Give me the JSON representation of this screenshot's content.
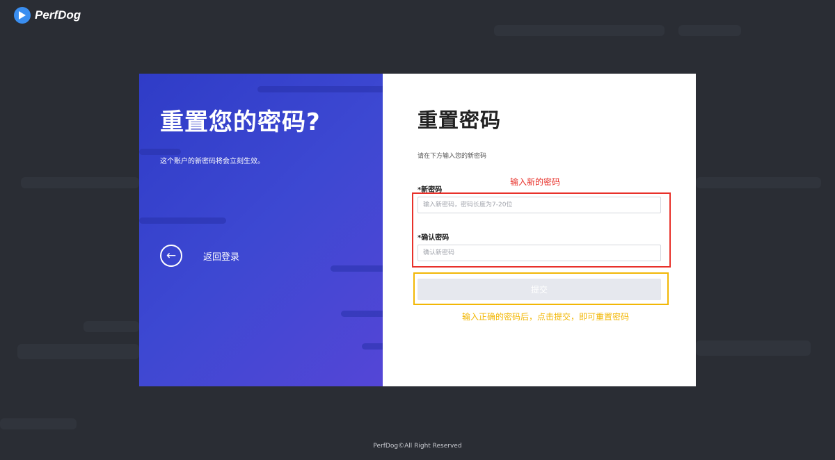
{
  "app": {
    "logo_text": "PerfDog"
  },
  "left_panel": {
    "title": "重置您的密码?",
    "description": "这个账户的新密码将会立刻生效。",
    "back_label": "返回登录",
    "back_icon": "arrow-left-icon"
  },
  "form": {
    "title": "重置密码",
    "subtitle": "请在下方输入您的新密码",
    "new_password": {
      "label": "*新密码",
      "placeholder": "输入新密码，密码长度为7-20位",
      "value": ""
    },
    "confirm_password": {
      "label": "*确认密码",
      "placeholder": "确认新密码",
      "value": ""
    },
    "submit_label": "提交"
  },
  "annotations": {
    "new_password_hint": "输入新的密码",
    "submit_hint": "输入正确的密码后，点击提交，即可重置密码"
  },
  "footer": {
    "copyright": "PerfDog©All Right Reserved"
  },
  "colors": {
    "background": "#2a2d34",
    "gradient_start": "#2f3cc7",
    "gradient_end": "#5446d6",
    "annotation_red": "#e8312a",
    "annotation_yellow": "#f2b705"
  }
}
